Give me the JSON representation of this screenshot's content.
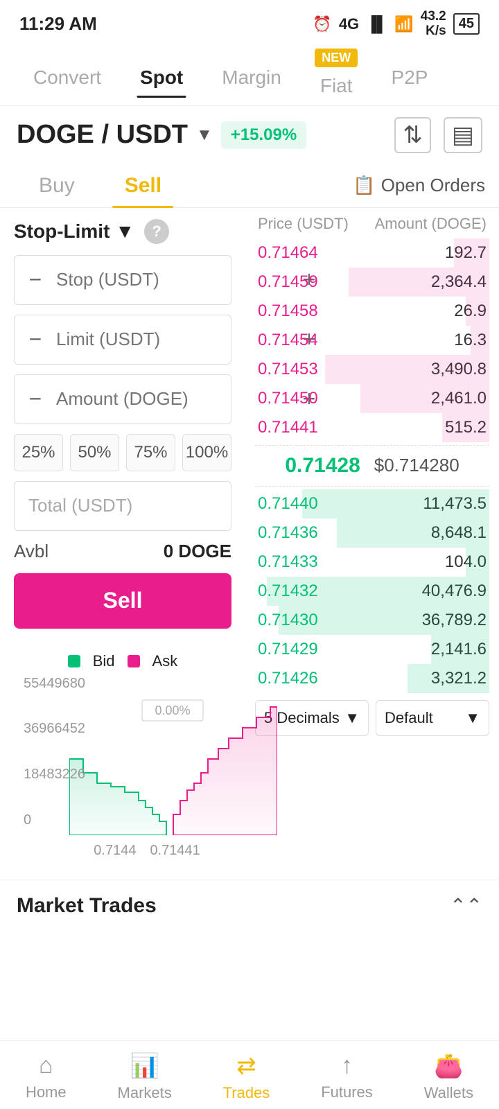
{
  "statusBar": {
    "time": "11:29 AM",
    "batteryPct": "45",
    "dataSpeed": "43.2\nK/s"
  },
  "nav": {
    "tabs": [
      "Convert",
      "Spot",
      "Margin",
      "Fiat",
      "P2P"
    ],
    "activeTab": "Spot",
    "newBadgeTab": "Fiat"
  },
  "pair": {
    "base": "DOGE",
    "quote": "USDT",
    "change": "+15.09%"
  },
  "tradeTabs": {
    "tabs": [
      "Buy",
      "Sell"
    ],
    "activeTab": "Sell",
    "openOrders": "Open Orders"
  },
  "orderForm": {
    "orderType": "Stop-Limit",
    "stopPlaceholder": "Stop (USDT)",
    "limitPlaceholder": "Limit (USDT)",
    "amountPlaceholder": "Amount (DOGE)",
    "totalPlaceholder": "Total (USDT)",
    "percentBtns": [
      "25%",
      "50%",
      "75%",
      "100%"
    ],
    "avblLabel": "Avbl",
    "avblValue": "0 DOGE",
    "sellBtn": "Sell"
  },
  "chart": {
    "legendBid": "Bid",
    "legendAsk": "Ask",
    "pctLabel": "0.00%",
    "yLabels": [
      "55449680",
      "36966452",
      "18483226",
      "0"
    ],
    "xLabels": [
      "0.7144",
      "0.71441"
    ]
  },
  "orderBook": {
    "headers": [
      "Price (USDT)",
      "Amount (DOGE)"
    ],
    "sellOrders": [
      {
        "price": "0.71464",
        "amount": "192.7",
        "bgPct": 15
      },
      {
        "price": "0.71459",
        "amount": "2,364.4",
        "bgPct": 60
      },
      {
        "price": "0.71458",
        "amount": "26.9",
        "bgPct": 10
      },
      {
        "price": "0.71454",
        "amount": "16.3",
        "bgPct": 8
      },
      {
        "price": "0.71453",
        "amount": "3,490.8",
        "bgPct": 70
      },
      {
        "price": "0.71450",
        "amount": "2,461.0",
        "bgPct": 55
      },
      {
        "price": "0.71441",
        "amount": "515.2",
        "bgPct": 20
      }
    ],
    "midPrice": "0.71428",
    "midUsd": "$0.714280",
    "buyOrders": [
      {
        "price": "0.71440",
        "amount": "11,473.5",
        "bgPct": 80
      },
      {
        "price": "0.71436",
        "amount": "8,648.1",
        "bgPct": 65
      },
      {
        "price": "0.71433",
        "amount": "104.0",
        "bgPct": 10
      },
      {
        "price": "0.71432",
        "amount": "40,476.9",
        "bgPct": 95
      },
      {
        "price": "0.71430",
        "amount": "36,789.2",
        "bgPct": 90
      },
      {
        "price": "0.71429",
        "amount": "2,141.6",
        "bgPct": 25
      },
      {
        "price": "0.71426",
        "amount": "3,321.2",
        "bgPct": 35
      }
    ],
    "decimalsLabel": "5 Decimals",
    "defaultLabel": "Default"
  },
  "marketTrades": {
    "title": "Market Trades"
  },
  "bottomNav": {
    "items": [
      "Home",
      "Markets",
      "Trades",
      "Futures",
      "Wallets"
    ],
    "activeItem": "Trades"
  }
}
